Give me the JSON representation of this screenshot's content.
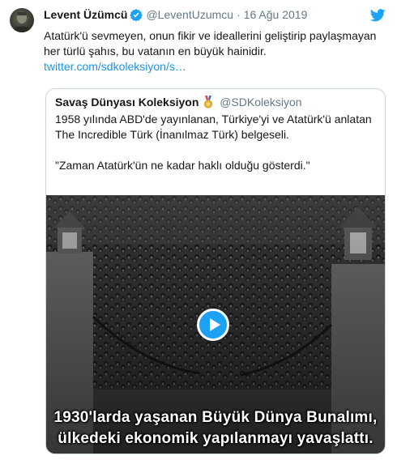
{
  "tweet": {
    "author_name": "Levent Üzümcü",
    "handle": "@LeventUzumcu",
    "separator": "·",
    "date": "16 Ağu 2019",
    "text_line1": "Atatürk'ü sevmeyen, onun fikir ve ideallerini geliştirip paylaşmayan",
    "text_line2": "her türlü şahıs, bu vatanın en büyük hainidir.",
    "link": "twitter.com/sdkoleksiyon/s…",
    "icons": {
      "verified": "verified-badge-icon",
      "brand": "twitter-bird-icon"
    },
    "colors": {
      "accent": "#1da1f2",
      "link": "#1b95e0",
      "secondary": "#657786"
    }
  },
  "quoted": {
    "author_name": "Savaş Dünyası Koleksiyon",
    "handle": "@SDKoleksiyon",
    "line1": "1958 yılında ABD'de yayınlanan, Türkiye'yi ve Atatürk'ü anlatan",
    "line2": "The Incredible Türk (İnanılmaz Türk) belgeseli.",
    "line3": "\"Zaman Atatürk'ün ne kadar haklı olduğu gösterdi.\"",
    "icons": {
      "badge": "medal-icon",
      "play": "play-icon"
    },
    "video": {
      "caption_line1": "1930'larda yaşanan Büyük Dünya Bunalımı,",
      "caption_line2": "ülkedeki ekonomik yapılanmayı yavaşlattı."
    }
  }
}
